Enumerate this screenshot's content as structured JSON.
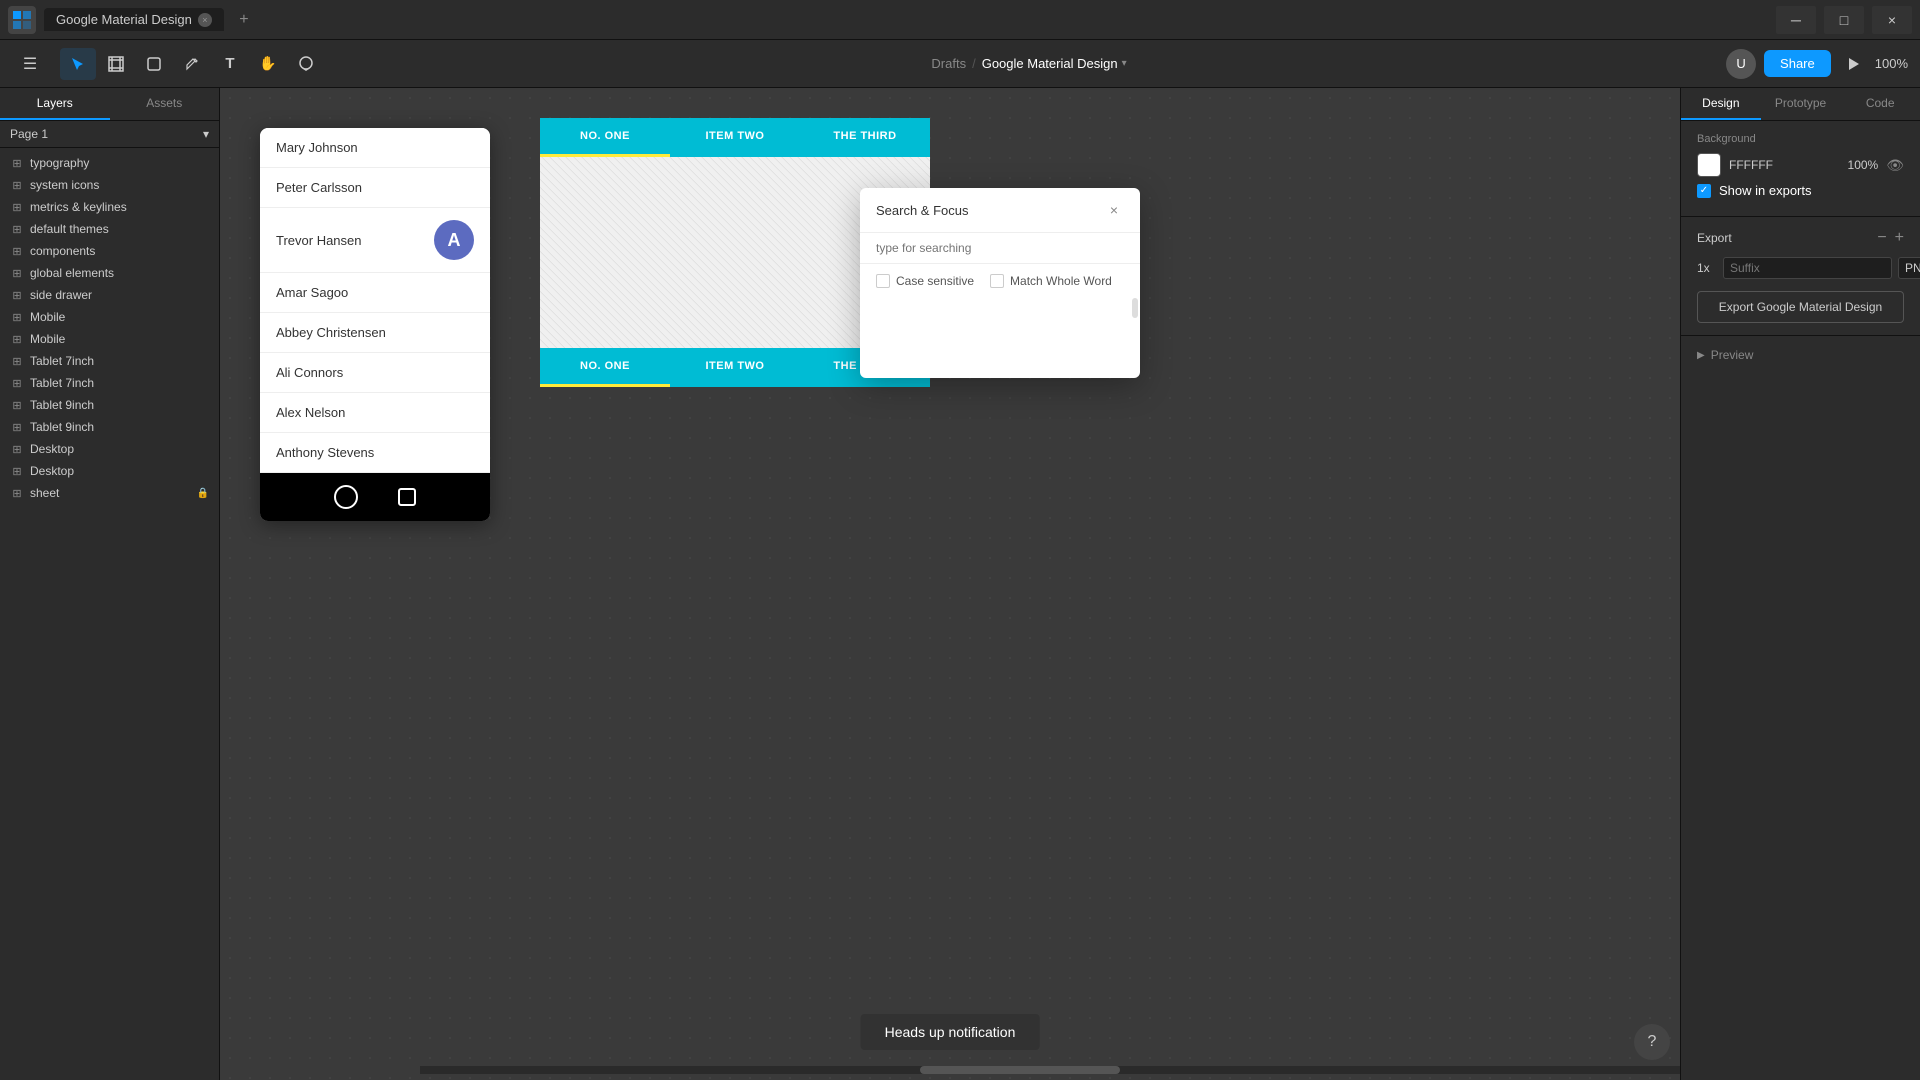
{
  "titlebar": {
    "logo": "F",
    "tab_label": "Google Material Design",
    "add_tab": "+",
    "dropdown_arrow": "▾"
  },
  "toolbar": {
    "move_tool": "↖",
    "frame_tool": "⬜",
    "shape_tool": "⬡",
    "text_tool": "T",
    "hand_tool": "✋",
    "comment_tool": "💬",
    "breadcrumb_drafts": "Drafts",
    "breadcrumb_sep": "/",
    "breadcrumb_current": "Google Material Design",
    "breadcrumb_arrow": "▾",
    "share_label": "Share",
    "zoom_level": "100%"
  },
  "sidebar": {
    "tabs": [
      "Layers",
      "Assets"
    ],
    "page_label": "Page 1",
    "layers": [
      {
        "name": "typography",
        "type": "frame",
        "indent": 0
      },
      {
        "name": "system icons",
        "type": "frame",
        "indent": 0
      },
      {
        "name": "metrics & keylines",
        "type": "frame",
        "indent": 0
      },
      {
        "name": "default themes",
        "type": "frame",
        "indent": 0
      },
      {
        "name": "components",
        "type": "frame",
        "indent": 0
      },
      {
        "name": "global elements",
        "type": "frame",
        "indent": 0
      },
      {
        "name": "side drawer",
        "type": "frame",
        "indent": 0
      },
      {
        "name": "Mobile",
        "type": "frame",
        "indent": 0
      },
      {
        "name": "Mobile",
        "type": "frame",
        "indent": 0
      },
      {
        "name": "Tablet 7inch",
        "type": "frame",
        "indent": 0
      },
      {
        "name": "Tablet 7inch",
        "type": "frame",
        "indent": 0
      },
      {
        "name": "Tablet 9inch",
        "type": "frame",
        "indent": 0
      },
      {
        "name": "Tablet 9inch",
        "type": "frame",
        "indent": 0
      },
      {
        "name": "Desktop",
        "type": "frame",
        "indent": 0
      },
      {
        "name": "Desktop",
        "type": "frame",
        "indent": 0
      },
      {
        "name": "sheet",
        "type": "frame",
        "indent": 0,
        "locked": true
      }
    ]
  },
  "canvas": {
    "mobile_list": [
      {
        "name": "Mary Johnson",
        "has_avatar": false
      },
      {
        "name": "Peter Carlsson",
        "has_avatar": false
      },
      {
        "name": "Trevor Hansen",
        "has_avatar": true,
        "avatar_letter": "A"
      },
      {
        "name": "Amar Sagoo",
        "has_avatar": false
      },
      {
        "name": "Abbey Christensen",
        "has_avatar": false
      },
      {
        "name": "Ali Connors",
        "has_avatar": false
      },
      {
        "name": "Alex Nelson",
        "has_avatar": false
      },
      {
        "name": "Anthony Stevens",
        "has_avatar": false
      }
    ],
    "tab_items": [
      "NO. ONE",
      "ITEM TWO",
      "THE THIRD"
    ],
    "notification_text": "Heads up notification"
  },
  "search_modal": {
    "title": "Search & Focus",
    "placeholder": "type for searching",
    "case_sensitive_label": "Case sensitive",
    "match_whole_word_label": "Match Whole Word"
  },
  "right_panel": {
    "tabs": [
      "Design",
      "Prototype",
      "Code"
    ],
    "background_label": "Background",
    "color_hex": "FFFFFF",
    "color_opacity": "100%",
    "show_in_exports_label": "Show in exports",
    "export_label": "Export",
    "export_scale": "1x",
    "export_suffix_placeholder": "Suffix",
    "export_format": "PNG",
    "export_btn_label": "Export Google Material Design",
    "preview_label": "Preview"
  }
}
